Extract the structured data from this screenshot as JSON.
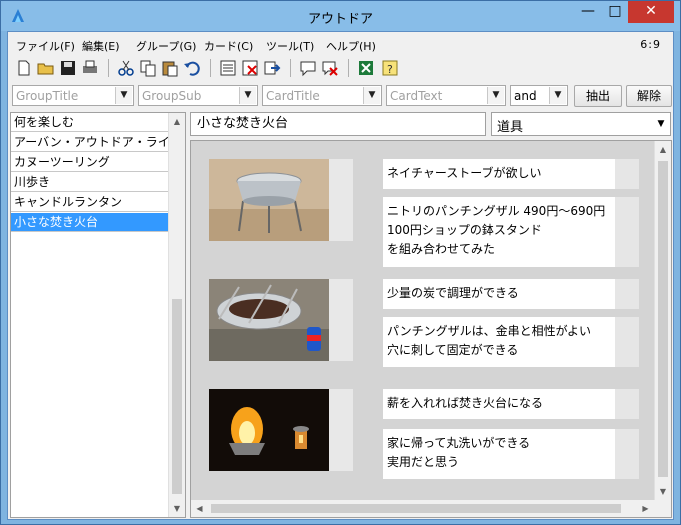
{
  "window": {
    "title": "アウトドア",
    "controls": {
      "minimize": "—",
      "maximize": "□",
      "close": "✕"
    }
  },
  "menu": {
    "items": [
      "ファイル(F)",
      "編集(E)",
      "グループ(G)",
      "カード(C)",
      "ツール(T)",
      "ヘルプ(H)"
    ],
    "counter": "6:9"
  },
  "toolbar": {
    "icons": [
      "new-file-icon",
      "open-folder-icon",
      "save-icon",
      "print-icon",
      "cut-icon",
      "copy-icon",
      "paste-icon",
      "undo-icon",
      "list-view-icon",
      "delete-card-icon",
      "export-icon",
      "comment-icon",
      "delete-comment-icon",
      "excel-icon",
      "help-note-icon"
    ]
  },
  "filters": {
    "group_title": "GroupTitle",
    "group_sub": "GroupSub",
    "card_title": "CardTitle",
    "card_text": "CardText",
    "logic": "and",
    "extract_label": "抽出",
    "clear_label": "解除"
  },
  "groups": {
    "items": [
      "何を楽しむ",
      "アーバン・アウトドア・ライフ",
      "カヌーツーリング",
      "川歩き",
      "キャンドルランタン",
      "小さな焚き火台"
    ],
    "selected_index": 5
  },
  "card": {
    "title": "小さな焚き火台",
    "category": "道具",
    "rows": [
      {
        "photo": "brazier-stand",
        "notes": [
          "ネイチャーストーブが欲しい",
          "ニトリのパンチングザル 490円～690円\n100円ショップの鉢スタンド\nを組み合わせてみた"
        ]
      },
      {
        "photo": "grilling-skewers",
        "notes": [
          "少量の炭で調理ができる",
          "パンチングザルは、金串と相性がよい\n穴に刺して固定ができる"
        ]
      },
      {
        "photo": "fire-at-night",
        "notes": [
          "薪を入れれば焚き火台になる",
          "家に帰って丸洗いができる\n実用だと思う"
        ]
      }
    ]
  },
  "colors": {
    "selection": "#3399ff",
    "close_button": "#c7372f",
    "titlebar": "#88bde8"
  }
}
